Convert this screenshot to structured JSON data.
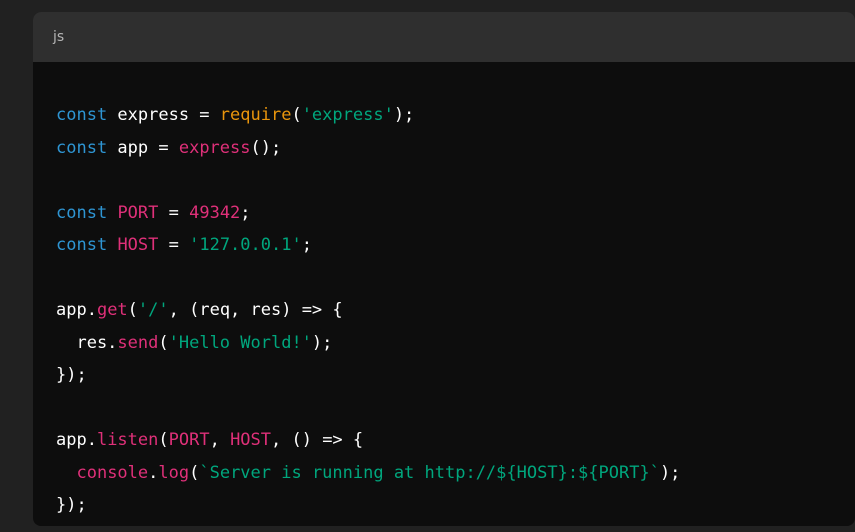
{
  "code_block": {
    "language": "js",
    "lines": [
      [
        {
          "t": "const",
          "k": "kw"
        },
        {
          "t": " express = ",
          "k": "plain"
        },
        {
          "t": "require",
          "k": "builtin"
        },
        {
          "t": "(",
          "k": "plain"
        },
        {
          "t": "'express'",
          "k": "str"
        },
        {
          "t": ");",
          "k": "plain"
        }
      ],
      [
        {
          "t": "const",
          "k": "kw"
        },
        {
          "t": " app = ",
          "k": "plain"
        },
        {
          "t": "express",
          "k": "call"
        },
        {
          "t": "();",
          "k": "plain"
        }
      ],
      [],
      [
        {
          "t": "const",
          "k": "kw"
        },
        {
          "t": " ",
          "k": "plain"
        },
        {
          "t": "PORT",
          "k": "call"
        },
        {
          "t": " = ",
          "k": "plain"
        },
        {
          "t": "49342",
          "k": "call"
        },
        {
          "t": ";",
          "k": "plain"
        }
      ],
      [
        {
          "t": "const",
          "k": "kw"
        },
        {
          "t": " ",
          "k": "plain"
        },
        {
          "t": "HOST",
          "k": "call"
        },
        {
          "t": " = ",
          "k": "plain"
        },
        {
          "t": "'127.0.0.1'",
          "k": "str"
        },
        {
          "t": ";",
          "k": "plain"
        }
      ],
      [],
      [
        {
          "t": "app.",
          "k": "plain"
        },
        {
          "t": "get",
          "k": "call"
        },
        {
          "t": "(",
          "k": "plain"
        },
        {
          "t": "'/'",
          "k": "str"
        },
        {
          "t": ", (req, res) => {",
          "k": "plain"
        }
      ],
      [
        {
          "t": "  res.",
          "k": "plain"
        },
        {
          "t": "send",
          "k": "call"
        },
        {
          "t": "(",
          "k": "plain"
        },
        {
          "t": "'Hello World!'",
          "k": "str"
        },
        {
          "t": ");",
          "k": "plain"
        }
      ],
      [
        {
          "t": "});",
          "k": "plain"
        }
      ],
      [],
      [
        {
          "t": "app.",
          "k": "plain"
        },
        {
          "t": "listen",
          "k": "call"
        },
        {
          "t": "(",
          "k": "plain"
        },
        {
          "t": "PORT",
          "k": "call"
        },
        {
          "t": ", ",
          "k": "plain"
        },
        {
          "t": "HOST",
          "k": "call"
        },
        {
          "t": ", () => {",
          "k": "plain"
        }
      ],
      [
        {
          "t": "  ",
          "k": "plain"
        },
        {
          "t": "console",
          "k": "call"
        },
        {
          "t": ".",
          "k": "plain"
        },
        {
          "t": "log",
          "k": "call"
        },
        {
          "t": "(",
          "k": "plain"
        },
        {
          "t": "`Server is running at http://${HOST}:${PORT}`",
          "k": "str"
        },
        {
          "t": ");",
          "k": "plain"
        }
      ],
      [
        {
          "t": "});",
          "k": "plain"
        }
      ]
    ]
  },
  "colors": {
    "page_bg": "#212121",
    "header_bg": "#2f2f2f",
    "code_bg": "#0d0d0d",
    "keyword": "#2e95d3",
    "string": "#00a67d",
    "call": "#df3079",
    "builtin": "#e9950c",
    "plain": "#ffffff"
  }
}
